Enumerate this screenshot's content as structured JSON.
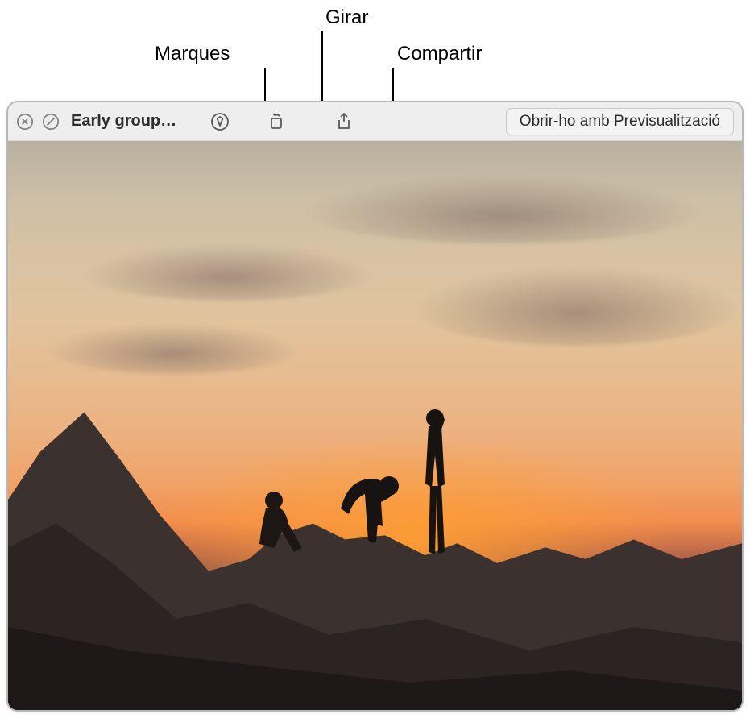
{
  "callouts": {
    "markup": "Marques",
    "rotate": "Girar",
    "share": "Compartir"
  },
  "window": {
    "title": "Early group…",
    "toolbar": {
      "markup_name": "markup-icon",
      "rotate_name": "rotate-icon",
      "share_name": "share-icon",
      "open_label": "Obrir-ho amb Previsualització"
    }
  }
}
